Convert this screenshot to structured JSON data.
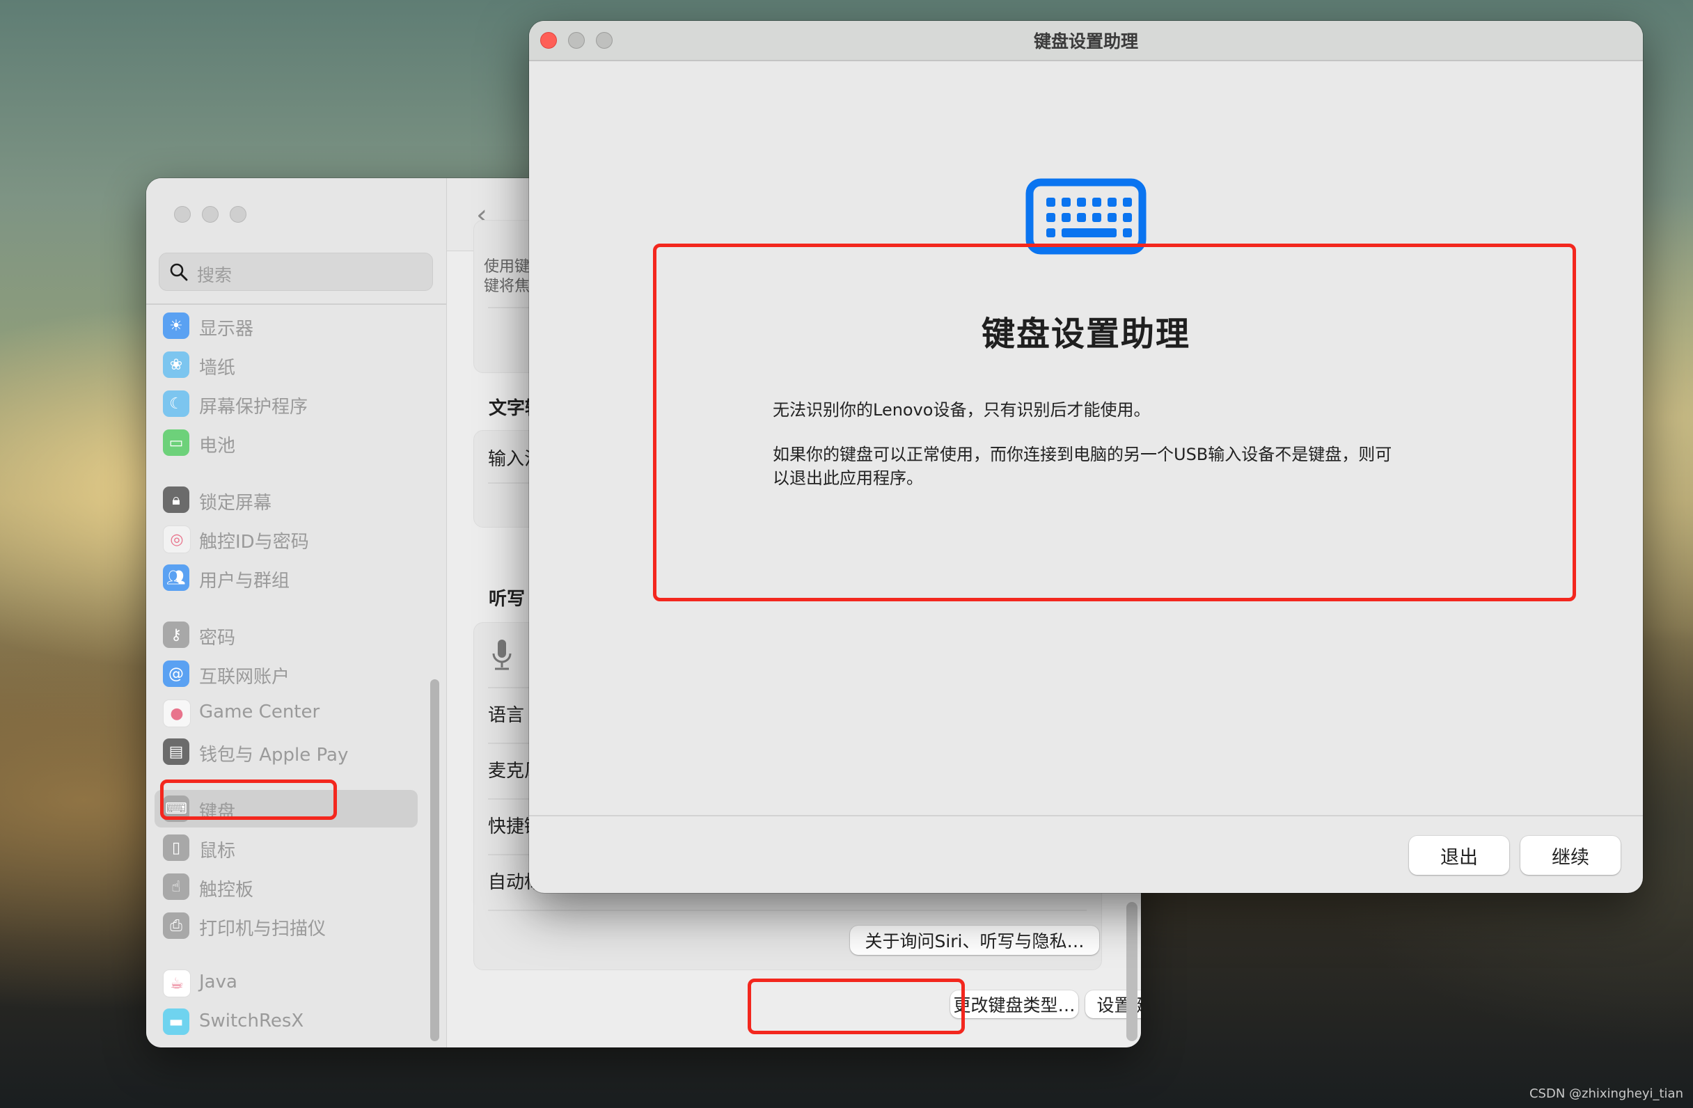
{
  "settings_window": {
    "search": {
      "placeholder": "搜索",
      "icon": "search-icon"
    },
    "sidebar": {
      "items": [
        {
          "label": "显示器",
          "icon": "display-brightness-icon",
          "color": "#5aa1f2"
        },
        {
          "label": "墙纸",
          "icon": "wallpaper-flower-icon",
          "color": "#7cc5ef"
        },
        {
          "label": "屏幕保护程序",
          "icon": "screensaver-icon",
          "color": "#7cc5ef"
        },
        {
          "label": "电池",
          "icon": "battery-icon",
          "color": "#6dd17a"
        },
        {
          "label": "锁定屏幕",
          "icon": "lock-icon",
          "color": "#6b6b6b"
        },
        {
          "label": "触控ID与密码",
          "icon": "fingerprint-icon",
          "color": "#f2f2f2"
        },
        {
          "label": "用户与群组",
          "icon": "users-icon",
          "color": "#5aa1f2"
        },
        {
          "label": "密码",
          "icon": "key-icon",
          "color": "#a8a8a8"
        },
        {
          "label": "互联网账户",
          "icon": "at-sign-icon",
          "color": "#5aa1f2"
        },
        {
          "label": "Game Center",
          "icon": "game-center-icon",
          "color": "#f7f7f7"
        },
        {
          "label": "钱包与 Apple Pay",
          "icon": "wallet-icon",
          "color": "#6b6b6b"
        },
        {
          "label": "键盘",
          "icon": "keyboard-icon",
          "color": "#a8a8a8",
          "selected": true
        },
        {
          "label": "鼠标",
          "icon": "mouse-icon",
          "color": "#a8a8a8"
        },
        {
          "label": "触控板",
          "icon": "trackpad-icon",
          "color": "#a8a8a8"
        },
        {
          "label": "打印机与扫描仪",
          "icon": "printer-icon",
          "color": "#a8a8a8"
        },
        {
          "label": "Java",
          "icon": "java-icon",
          "color": "#ffffff"
        },
        {
          "label": "SwitchResX",
          "icon": "monitor-icon",
          "color": "#6fd3ef"
        }
      ]
    },
    "content": {
      "back_label": "‹",
      "partial_text_line1": "使用键",
      "partial_text_line2": "键将焦",
      "section_text_input": "文字输",
      "row_input_sources": "输入法",
      "section_dictation": "听写",
      "row_dictation_partial": "",
      "row_language": "语言",
      "row_microphone": "麦克风",
      "row_shortcut": "快捷键",
      "row_auto_punct": "自动标",
      "about_siri_button": "关于询问Siri、听写与隐私…",
      "change_keyboard_type_button": "更改键盘类型…",
      "setup_keyboard_button": "设置键盘…",
      "help_button": "?"
    }
  },
  "assistant_window": {
    "title": "键盘设置助理",
    "icon": "keyboard-icon",
    "icon_color": "#0a74f0",
    "heading": "键盘设置助理",
    "paragraph1": "无法识别你的Lenovo设备，只有识别后才能使用。",
    "paragraph2": "如果你的键盘可以正常使用，而你连接到电脑的另一个USB输入设备不是键盘，则可以退出此应用程序。",
    "quit_button": "退出",
    "continue_button": "继续"
  },
  "annotation_color": "#f3271e",
  "watermark": "CSDN @zhixingheyi_tian"
}
